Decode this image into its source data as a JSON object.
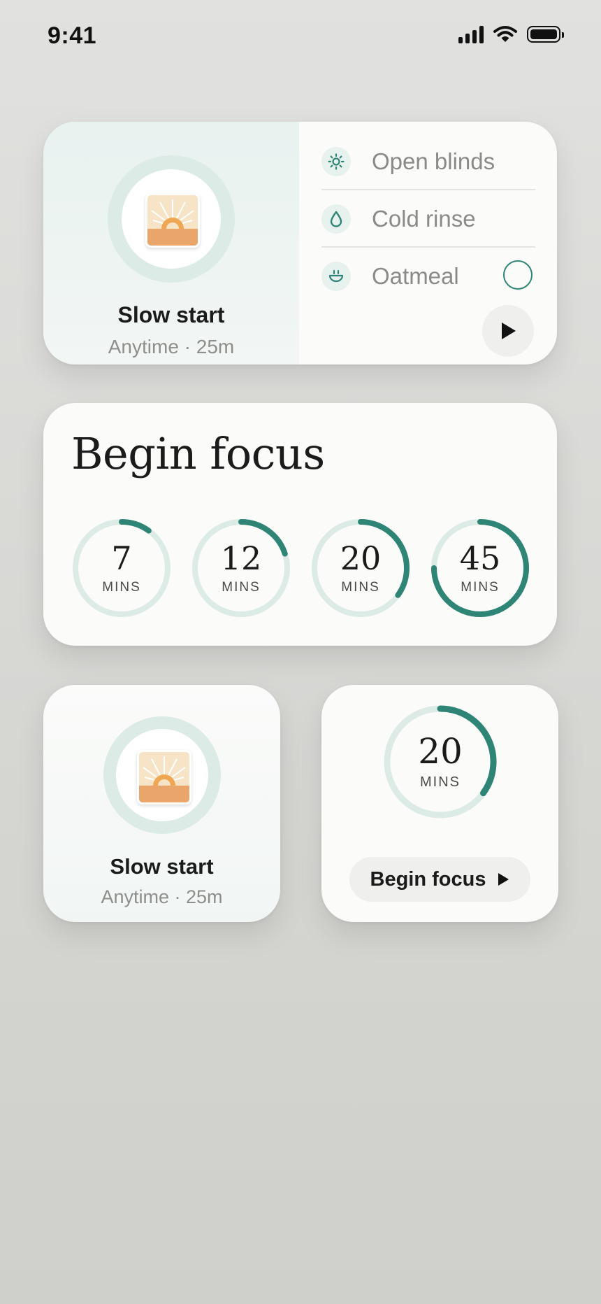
{
  "status_bar": {
    "time": "9:41"
  },
  "colors": {
    "accent": "#2f8575",
    "track": "#dcebe6",
    "card": "#fbfbfa"
  },
  "routine_card": {
    "title": "Slow start",
    "subtitle": "Anytime · 25m",
    "icon": "sunrise-icon",
    "tasks": [
      {
        "label": "Open blinds",
        "icon": "sun-icon"
      },
      {
        "label": "Cold rinse",
        "icon": "droplet-icon"
      },
      {
        "label": "Oatmeal",
        "icon": "bowl-icon",
        "checked": false
      }
    ]
  },
  "focus_card": {
    "title": "Begin focus",
    "timers": [
      {
        "value": "7",
        "unit": "MINS",
        "progress": 0.1
      },
      {
        "value": "12",
        "unit": "MINS",
        "progress": 0.2
      },
      {
        "value": "20",
        "unit": "MINS",
        "progress": 0.35
      },
      {
        "value": "45",
        "unit": "MINS",
        "progress": 0.75
      }
    ]
  },
  "small_routine": {
    "title": "Slow start",
    "subtitle": "Anytime · 25m",
    "icon": "sunrise-icon"
  },
  "small_focus": {
    "value": "20",
    "unit": "MINS",
    "progress": 0.35,
    "button_label": "Begin focus"
  }
}
